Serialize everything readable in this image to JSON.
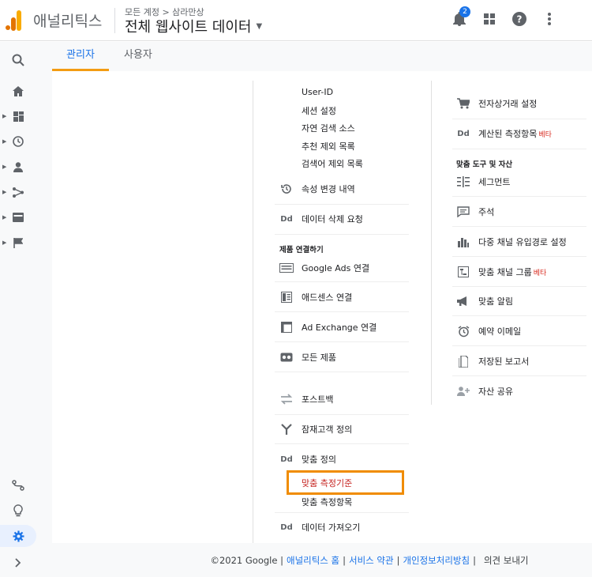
{
  "header": {
    "app_name": "애널리틱스",
    "breadcrumb": "모든 계정 > 삼라만상",
    "account_title": "전체 웹사이트 데이터",
    "notification_count": "2"
  },
  "tabs": [
    {
      "label": "관리자"
    },
    {
      "label": "사용자"
    }
  ],
  "middle": {
    "sub_items": [
      "User-ID",
      "세션 설정",
      "자연 검색 소스",
      "추천 제외 목록",
      "검색어 제외 목록"
    ],
    "property_history": "속성 변경 내역",
    "data_delete": "데이터 삭제 요청",
    "product_link_section": "제품 연결하기",
    "google_ads": "Google Ads 연결",
    "adsense": "애드센스 연결",
    "ad_exchange": "Ad Exchange 연결",
    "all_products": "모든 제품",
    "postback": "포스트백",
    "audience": "잠재고객 정의",
    "custom_definitions": "맞춤 정의",
    "custom_dimensions": "맞춤 측정기준",
    "custom_metrics": "맞춤 측정항목",
    "data_import": "데이터 가져오기",
    "dd_label": "Dd"
  },
  "right": {
    "ecommerce": "전자상거래 설정",
    "calculated_metrics": "계산된 측정항목",
    "beta": "베타",
    "tools_section": "맞춤 도구 및 자산",
    "segments": "세그먼트",
    "annotations": "주석",
    "mcf_settings": "다중 채널 유입경로 설정",
    "channel_grouping": "맞춤 채널 그룹",
    "custom_alerts": "맞춤 알림",
    "scheduled_emails": "예약 이메일",
    "saved_reports": "저장된 보고서",
    "share_assets": "자산 공유",
    "dd_label": "Dd"
  },
  "footer": {
    "copyright": "©2021 Google |",
    "link_home": "애널리틱스 홈",
    "link_terms": "서비스 약관",
    "link_privacy": "개인정보처리방침",
    "sep": "|",
    "feedback": "의견 보내기"
  },
  "colors": {
    "accent": "#1a73e8",
    "highlight": "#f08c00",
    "logo_orange": "#f9ab00",
    "logo_dark": "#e37400"
  }
}
